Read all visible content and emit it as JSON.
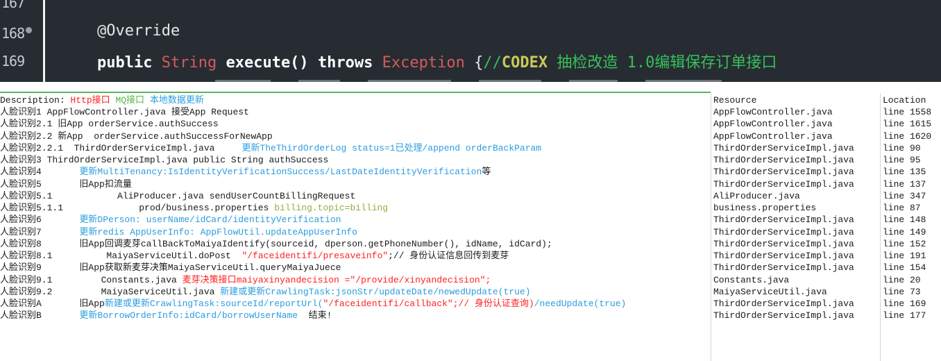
{
  "editor": {
    "lines": [
      {
        "number": "167",
        "fold": false
      },
      {
        "number": "168",
        "fold": true
      },
      {
        "number": "169",
        "fold": false
      }
    ],
    "annotation": "@Override",
    "sig_public": "public",
    "sig_type": "String",
    "sig_method": "execute()",
    "sig_throws": "throws",
    "sig_exception": "Exception",
    "sig_brace": " {",
    "sig_comment_prefix": "//",
    "sig_todo_tag": "CODEX",
    "sig_comment_rest": " 抽检改造 1.0编辑保存订单接口"
  },
  "tasks": {
    "headers": {
      "description_label": "Description: ",
      "legend_http": "Http接口",
      "legend_mq": "MQ接口",
      "legend_local": "本地数据更新",
      "resource": "Resource",
      "location": "Location"
    },
    "rows": [
      {
        "parts": [
          {
            "t": "人脸识别1 AppFlowController.java 接受App Request",
            "c": ""
          }
        ],
        "resource": "AppFlowController.java",
        "location": "line 1558"
      },
      {
        "parts": [
          {
            "t": "人脸识别2.1 旧App orderService.authSuccess",
            "c": ""
          }
        ],
        "resource": "AppFlowController.java",
        "location": "line 1615"
      },
      {
        "parts": [
          {
            "t": "人脸识别2.2 新App  orderService.authSuccessForNewApp",
            "c": ""
          }
        ],
        "resource": "AppFlowController.java",
        "location": "line 1620"
      },
      {
        "parts": [
          {
            "t": "人脸识别2.2.1  ThirdOrderServiceImpl.java     ",
            "c": ""
          },
          {
            "t": "更新TheThirdOrderLog status=1已处理/append orderBackParam",
            "c": "blue"
          }
        ],
        "resource": "ThirdOrderServiceImpl.java",
        "location": "line 90"
      },
      {
        "parts": [
          {
            "t": "人脸识别3 ThirdOrderServiceImpl.java public String authSuccess",
            "c": ""
          }
        ],
        "resource": "ThirdOrderServiceImpl.java",
        "location": "line 95"
      },
      {
        "parts": [
          {
            "t": "人脸识别4       ",
            "c": ""
          },
          {
            "t": "更新MultiTenancy:IsIdentityVerificationSuccess/LastDateIdentityVerification",
            "c": "blue"
          },
          {
            "t": "等",
            "c": ""
          }
        ],
        "resource": "ThirdOrderServiceImpl.java",
        "location": "line 135"
      },
      {
        "parts": [
          {
            "t": "人脸识别5       旧App扣流量",
            "c": ""
          }
        ],
        "resource": "ThirdOrderServiceImpl.java",
        "location": "line 137"
      },
      {
        "parts": [
          {
            "t": "人脸识别5.1            AliProducer.java sendUserCountBillingRequest",
            "c": ""
          }
        ],
        "resource": "AliProducer.java",
        "location": "line 347"
      },
      {
        "parts": [
          {
            "t": "人脸识别5.1.1              prod/business.properties ",
            "c": ""
          },
          {
            "t": "billing.topic=billing",
            "c": "olive"
          }
        ],
        "resource": "business.properties",
        "location": "line 87"
      },
      {
        "parts": [
          {
            "t": "人脸识别6       ",
            "c": ""
          },
          {
            "t": "更新DPerson: userName/idCard/identityVerification",
            "c": "blue"
          }
        ],
        "resource": "ThirdOrderServiceImpl.java",
        "location": "line 148"
      },
      {
        "parts": [
          {
            "t": "人脸识别7       ",
            "c": ""
          },
          {
            "t": "更新redis AppUserInfo: AppFlowUtil.updateAppUserInfo",
            "c": "blue"
          }
        ],
        "resource": "ThirdOrderServiceImpl.java",
        "location": "line 149"
      },
      {
        "parts": [
          {
            "t": "人脸识别8       旧App回调麦芽callBackToMaiyaIdentify(sourceid, dperson.getPhoneNumber(), idName, idCard);",
            "c": ""
          }
        ],
        "resource": "ThirdOrderServiceImpl.java",
        "location": "line 152"
      },
      {
        "parts": [
          {
            "t": "人脸识别8.1          MaiyaServiceUtil.doPost  ",
            "c": ""
          },
          {
            "t": "\"/faceidentifi/presaveinfo\"",
            "c": "red"
          },
          {
            "t": ";// 身份认证信息回传到麦芽",
            "c": ""
          }
        ],
        "resource": "ThirdOrderServiceImpl.java",
        "location": "line 191"
      },
      {
        "parts": [
          {
            "t": "人脸识别9       旧App获取新麦芽决策MaiyaServiceUtil.queryMaiyaJuece",
            "c": ""
          }
        ],
        "resource": "ThirdOrderServiceImpl.java",
        "location": "line 154"
      },
      {
        "parts": [
          {
            "t": "人脸识别9.1         Constants.java ",
            "c": ""
          },
          {
            "t": "麦芽决策接口maiyaxinyandecision =\"/provide/xinyandecision\";",
            "c": "red"
          }
        ],
        "resource": "Constants.java",
        "location": "line 20"
      },
      {
        "parts": [
          {
            "t": "人脸识别9.2         MaiyaServiceUtil.java ",
            "c": ""
          },
          {
            "t": "新建或更新CrawlingTask:jsonStr/updateDate/newedUpdate(true)",
            "c": "blue"
          }
        ],
        "resource": "MaiyaServiceUtil.java",
        "location": "line 73"
      },
      {
        "parts": [
          {
            "t": "人脸识别A       旧App",
            "c": ""
          },
          {
            "t": "新建或更新CrawlingTask:sourceId/reportUrl(",
            "c": "blue"
          },
          {
            "t": "\"/faceidentifi/callback\";// 身份认证查询)",
            "c": "red"
          },
          {
            "t": "/needUpdate(true)",
            "c": "blue"
          }
        ],
        "resource": "ThirdOrderServiceImpl.java",
        "location": "line 169"
      },
      {
        "parts": [
          {
            "t": "人脸识别B       ",
            "c": ""
          },
          {
            "t": "更新BorrowOrderInfo:idCard/borrowUserName",
            "c": "blue"
          },
          {
            "t": "  结束!",
            "c": ""
          }
        ],
        "resource": "ThirdOrderServiceImpl.java",
        "location": "line 177"
      }
    ]
  }
}
